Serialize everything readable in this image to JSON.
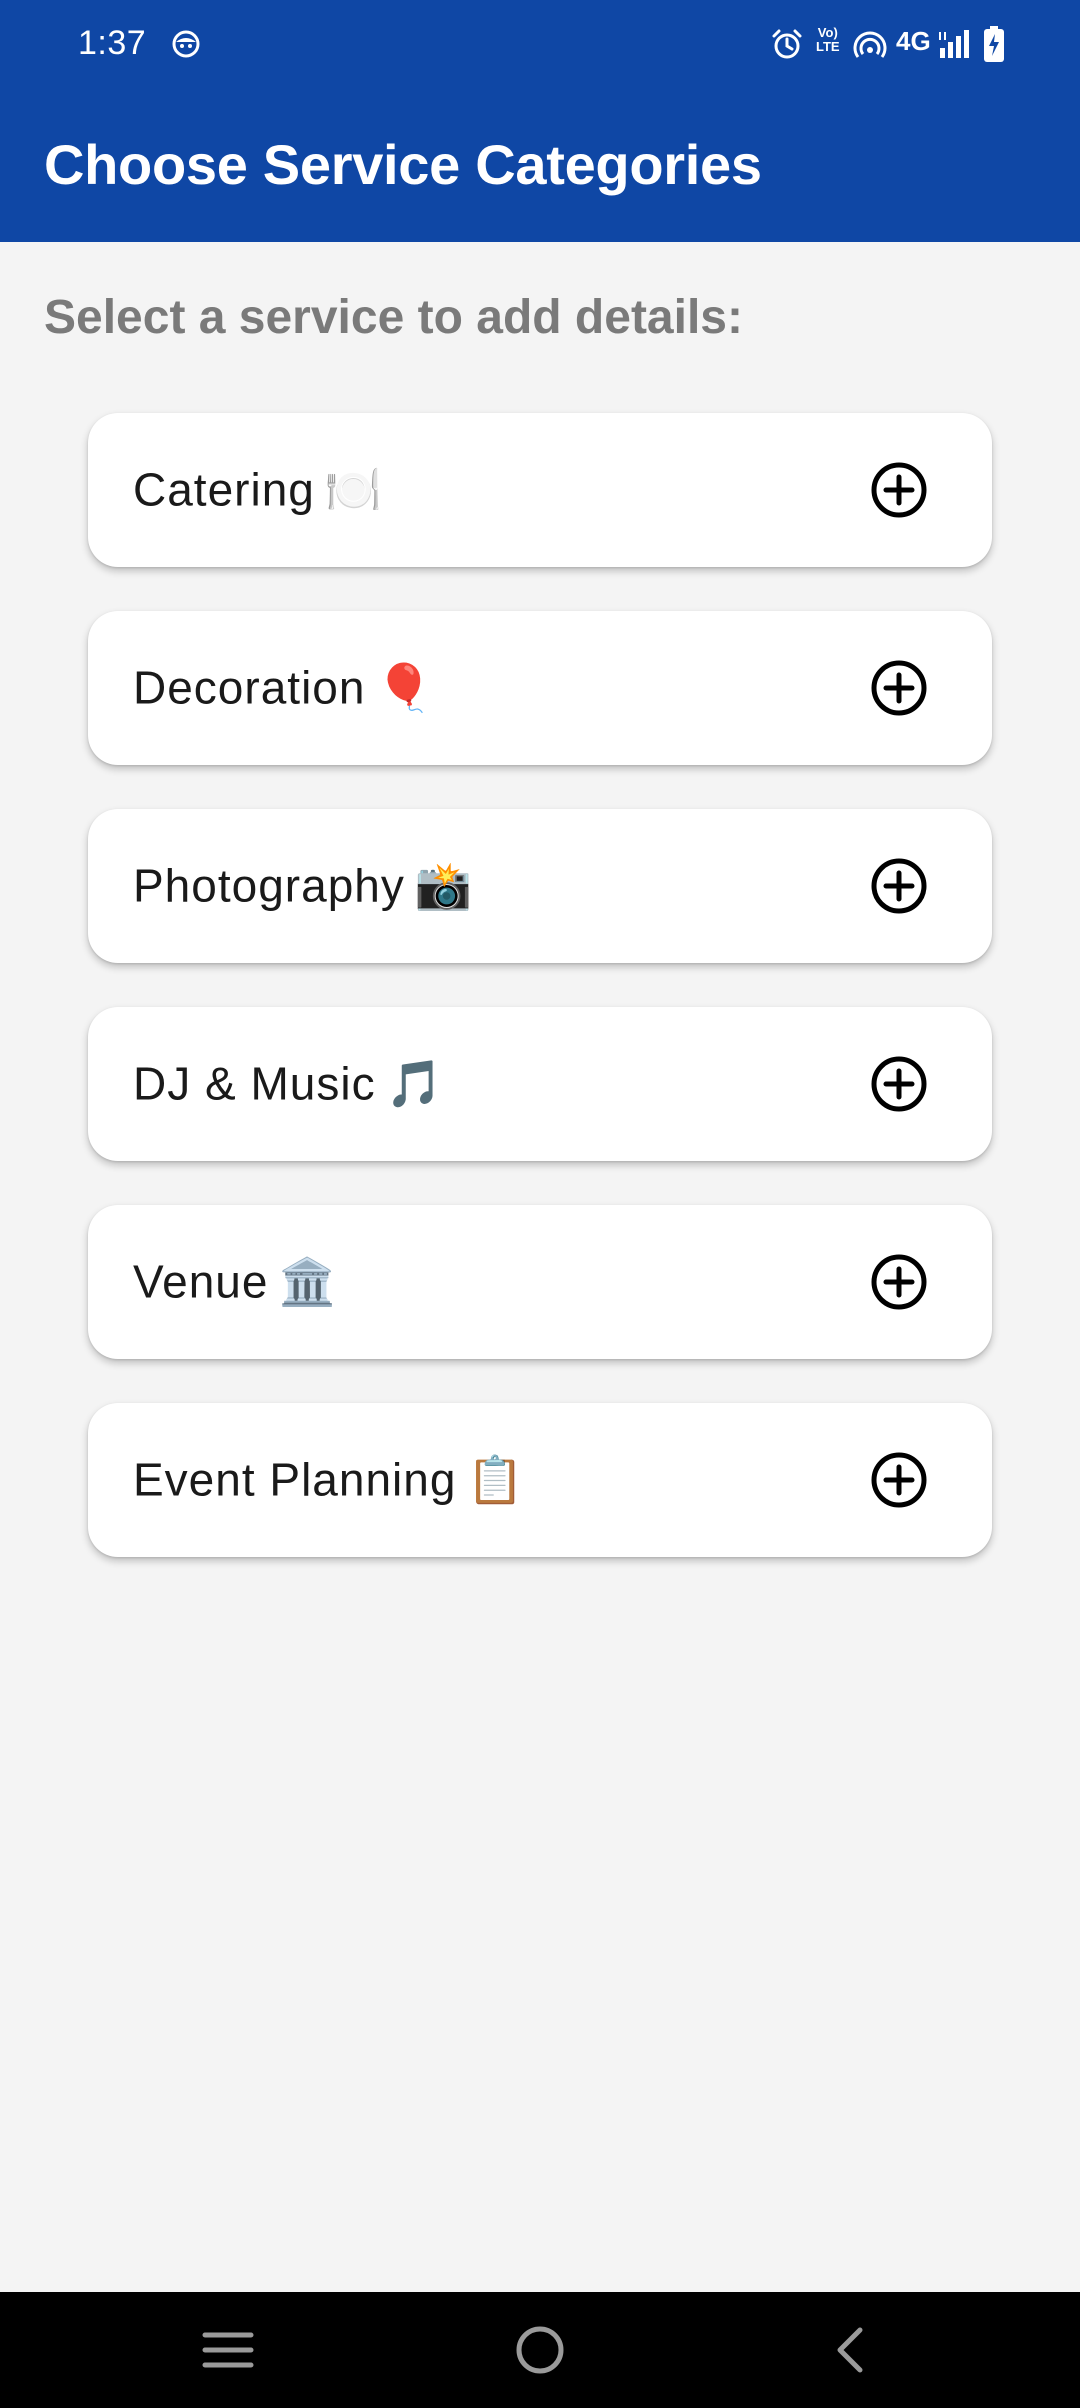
{
  "status_bar": {
    "time": "1:37",
    "network": "4G",
    "volte_line1": "Vo)",
    "volte_line2": "LTE",
    "icons": [
      "face-notification-icon",
      "alarm-icon",
      "volte-icon",
      "hotspot-icon",
      "signal-icon",
      "battery-charging-icon"
    ]
  },
  "app_bar": {
    "title": "Choose Service Categories",
    "background_color": "#0f47a5"
  },
  "main": {
    "subtitle": "Select a service to add details:",
    "categories": [
      {
        "label": "Catering",
        "emoji": "🍽️",
        "action_icon": "add-circle-icon"
      },
      {
        "label": "Decoration",
        "emoji": "🎈",
        "action_icon": "add-circle-icon"
      },
      {
        "label": "Photography",
        "emoji": "📸",
        "action_icon": "add-circle-icon"
      },
      {
        "label": "DJ & Music",
        "emoji": "🎵",
        "action_icon": "add-circle-icon"
      },
      {
        "label": "Venue",
        "emoji": "🏛️",
        "action_icon": "add-circle-icon"
      },
      {
        "label": "Event Planning",
        "emoji": "📋",
        "action_icon": "add-circle-icon"
      }
    ]
  },
  "nav_bar": {
    "buttons": [
      "recent-apps-icon",
      "home-icon",
      "back-icon"
    ]
  }
}
